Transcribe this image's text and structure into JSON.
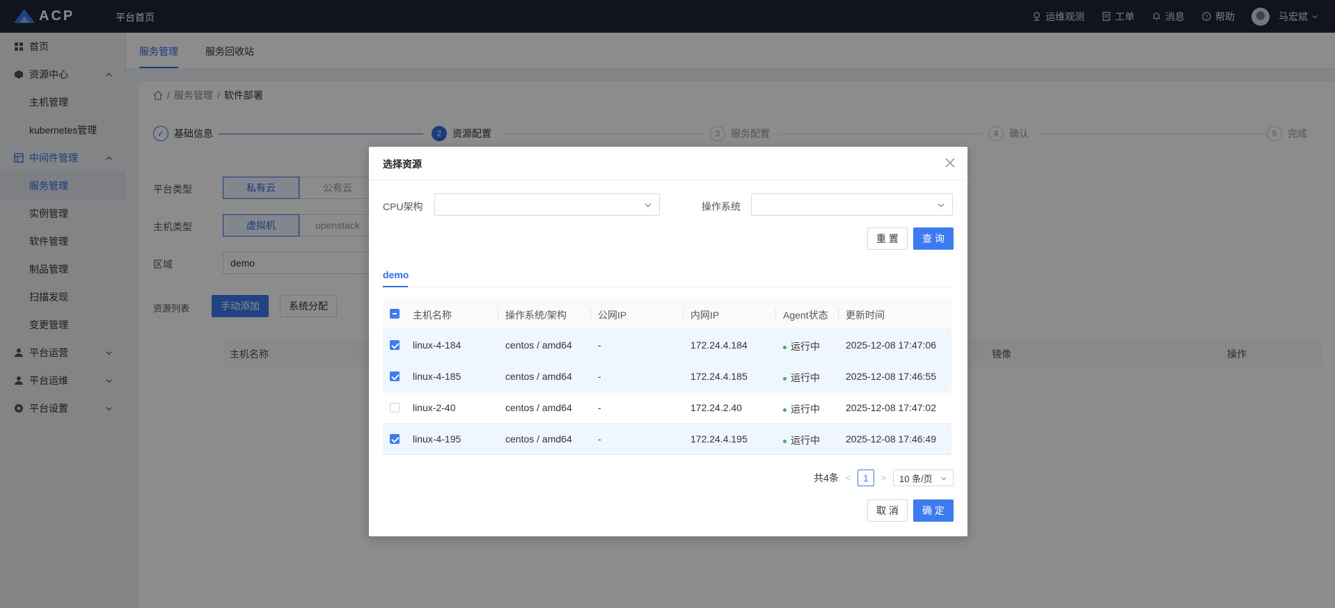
{
  "topbar": {
    "logo_text": "ACP",
    "home": "平台首页",
    "items": [
      {
        "label": "运维观测",
        "icon": "location-icon"
      },
      {
        "label": "工单",
        "icon": "clipboard-icon"
      },
      {
        "label": "消息",
        "icon": "bell-icon"
      },
      {
        "label": "帮助",
        "icon": "help-icon"
      }
    ],
    "user": "马宏斌"
  },
  "sidebar": {
    "items": [
      {
        "label": "首页",
        "icon": "grid-icon"
      },
      {
        "label": "资源中心",
        "icon": "cube-icon",
        "expanded": true
      },
      {
        "label": "主机管理"
      },
      {
        "label": "kubernetes管理"
      },
      {
        "label": "中间件管理",
        "icon": "layout-icon",
        "expanded": true
      },
      {
        "label": "服务管理",
        "active": true
      },
      {
        "label": "实例管理"
      },
      {
        "label": "软件管理"
      },
      {
        "label": "制品管理"
      },
      {
        "label": "扫描发现"
      },
      {
        "label": "变更管理"
      },
      {
        "label": "平台运营",
        "icon": "user-icon"
      },
      {
        "label": "平台运维",
        "icon": "user-icon"
      },
      {
        "label": "平台设置",
        "icon": "settings-icon"
      }
    ]
  },
  "tabs": [
    "服务管理",
    "服务回收站"
  ],
  "breadcrumb": [
    "服务管理",
    "软件部署"
  ],
  "steps": [
    {
      "num": "",
      "label": "基础信息",
      "state": "done"
    },
    {
      "num": "2",
      "label": "资源配置",
      "state": "current"
    },
    {
      "num": "3",
      "label": "服务配置",
      "state": "todo"
    },
    {
      "num": "4",
      "label": "确认",
      "state": "todo"
    },
    {
      "num": "5",
      "label": "完成",
      "state": "todo"
    }
  ],
  "form": {
    "platform_label": "平台类型",
    "platform_options": [
      "私有云",
      "公有云"
    ],
    "host_label": "主机类型",
    "host_options": [
      "虚拟机",
      "openstack"
    ],
    "region_label": "区域",
    "region_value": "demo",
    "resource_label": "资源列表",
    "manual_add": "手动添加",
    "system_assign": "系统分配",
    "bg_columns": [
      "主机名称",
      "镜像",
      "操作"
    ]
  },
  "dialog": {
    "title": "选择资源",
    "cpu_label": "CPU架构",
    "os_label": "操作系统",
    "reset": "重 置",
    "query": "查 询",
    "region_tab": "demo",
    "columns": [
      "主机名称",
      "操作系统/架构",
      "公网IP",
      "内网IP",
      "Agent状态",
      "更新时间"
    ],
    "rows": [
      {
        "checked": true,
        "name": "linux-4-184",
        "os": "centos / amd64",
        "public_ip": "-",
        "private_ip": "172.24.4.184",
        "status": "运行中",
        "updated": "2025-12-08 17:47:06"
      },
      {
        "checked": true,
        "name": "linux-4-185",
        "os": "centos / amd64",
        "public_ip": "-",
        "private_ip": "172.24.4.185",
        "status": "运行中",
        "updated": "2025-12-08 17:46:55"
      },
      {
        "checked": false,
        "name": "linux-2-40",
        "os": "centos / amd64",
        "public_ip": "-",
        "private_ip": "172.24.2.40",
        "status": "运行中",
        "updated": "2025-12-08 17:47:02"
      },
      {
        "checked": true,
        "name": "linux-4-195",
        "os": "centos / amd64",
        "public_ip": "-",
        "private_ip": "172.24.4.195",
        "status": "运行中",
        "updated": "2025-12-08 17:46:49"
      }
    ],
    "pager": {
      "total": "共4条",
      "page": "1",
      "size": "10 条/页"
    },
    "cancel": "取 消",
    "confirm": "确 定"
  },
  "colors": {
    "primary": "#3d7bf0",
    "topbar": "#1f2335",
    "status_ok": "#3bb54a"
  }
}
